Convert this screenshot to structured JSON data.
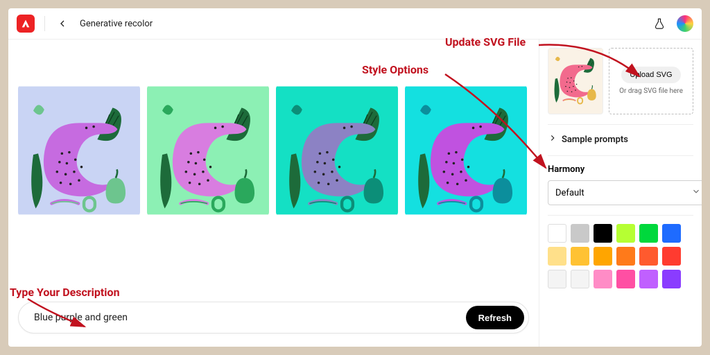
{
  "header": {
    "page_title": "Generative recolor"
  },
  "annotations": {
    "update_svg": "Update SVG File",
    "style_options": "Style Options",
    "type_description": "Type Your Description"
  },
  "results": {
    "tiles": [
      {
        "bg": "#c9d4f4",
        "cat": "#c66be0",
        "leaf": "#1d6b3a",
        "accent": "#6dc58e"
      },
      {
        "bg": "#8cf0b4",
        "cat": "#d87de0",
        "leaf": "#1d6b3a",
        "accent": "#2aa85c"
      },
      {
        "bg": "#14e0c4",
        "cat": "#8c82c4",
        "leaf": "#1d6b3a",
        "accent": "#0c8e78"
      },
      {
        "bg": "#14e0e0",
        "cat": "#c052e0",
        "leaf": "#1d6b3a",
        "accent": "#0c8e9c"
      }
    ]
  },
  "prompt": {
    "value": "Blue purple and green",
    "refresh_label": "Refresh"
  },
  "side": {
    "upload_label": "Upload SVG",
    "drag_text": "Or drag SVG file here",
    "sample_prompts_label": "Sample prompts",
    "harmony_label": "Harmony",
    "harmony_value": "Default",
    "thumb": {
      "bg": "#faf2e6",
      "cat": "#f26a8d",
      "leaf": "#1d6b3a",
      "accent": "#e7b84a"
    },
    "swatches": [
      "#ffffff",
      "#c9c9c9",
      "#000000",
      "#b6ff33",
      "#00d83c",
      "#1e6bff",
      "#ffe08a",
      "#ffc233",
      "#ffa500",
      "#ff7a1a",
      "#ff5a2e",
      "#ff3b30",
      "#f4f4f4",
      "#f4f4f4",
      "#ff8cc6",
      "#ff4fa3",
      "#c060ff",
      "#8a3cff"
    ]
  }
}
